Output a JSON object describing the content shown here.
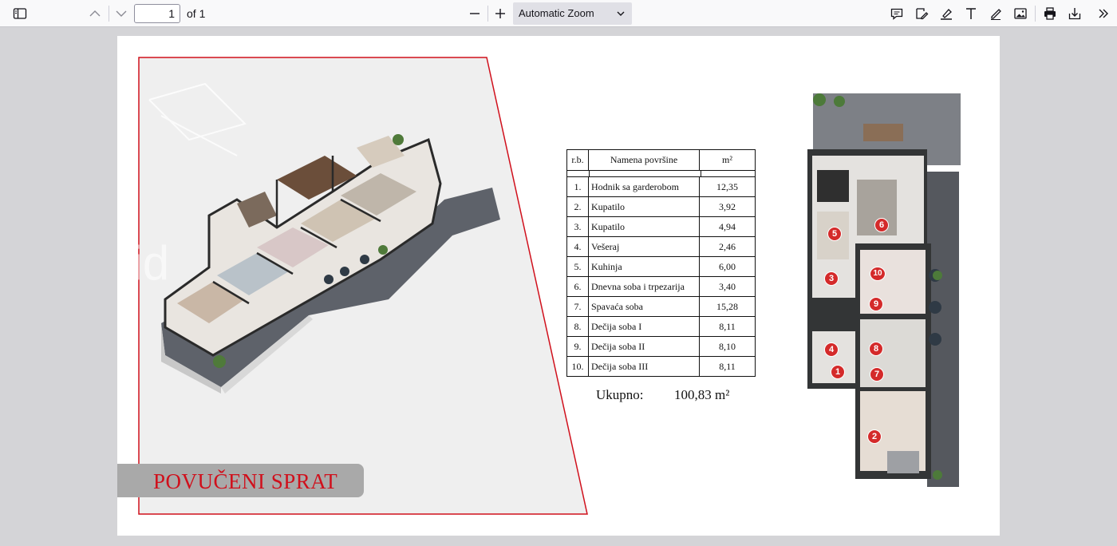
{
  "toolbar": {
    "page_number": "1",
    "page_count_label": "of 1",
    "zoom_label": "Automatic Zoom",
    "icons": [
      "sidebar-toggle-icon",
      "previous-page-icon",
      "next-page-icon",
      "zoom-out-icon",
      "zoom-in-icon",
      "comment-icon",
      "signature-icon",
      "highlight-icon",
      "text-icon",
      "draw-icon",
      "image-icon",
      "print-icon",
      "save-icon",
      "more-tools-icon"
    ]
  },
  "document": {
    "table": {
      "headers": [
        "r.b.",
        "Namena površine",
        "m²"
      ],
      "rows": [
        [
          "1.",
          "Hodnik sa garderobom",
          "12,35"
        ],
        [
          "2.",
          "Kupatilo",
          "3,92"
        ],
        [
          "3.",
          "Kupatilo",
          "4,94"
        ],
        [
          "4.",
          "Vešeraj",
          "2,46"
        ],
        [
          "5.",
          "Kuhinja",
          "6,00"
        ],
        [
          "6.",
          "Dnevna soba i trpezarija",
          "3,40"
        ],
        [
          "7.",
          "Spavaća soba",
          "15,28"
        ],
        [
          "8.",
          "Dečija soba I",
          "8,11"
        ],
        [
          "9.",
          "Dečija soba II",
          "8,10"
        ],
        [
          "10.",
          "Dečija soba III",
          "8,11"
        ]
      ]
    },
    "total_label": "Ukupno:",
    "total_value": "100,83 m²",
    "banner_title": "POVUČENI SPRAT",
    "plan_markers": [
      "1",
      "2",
      "3",
      "4",
      "5",
      "6",
      "7",
      "8",
      "9",
      "10"
    ]
  },
  "colors": {
    "accent_red": "#d0101c",
    "toolbar_bg": "#f9f9fa",
    "viewer_bg": "#d4d4d7"
  }
}
